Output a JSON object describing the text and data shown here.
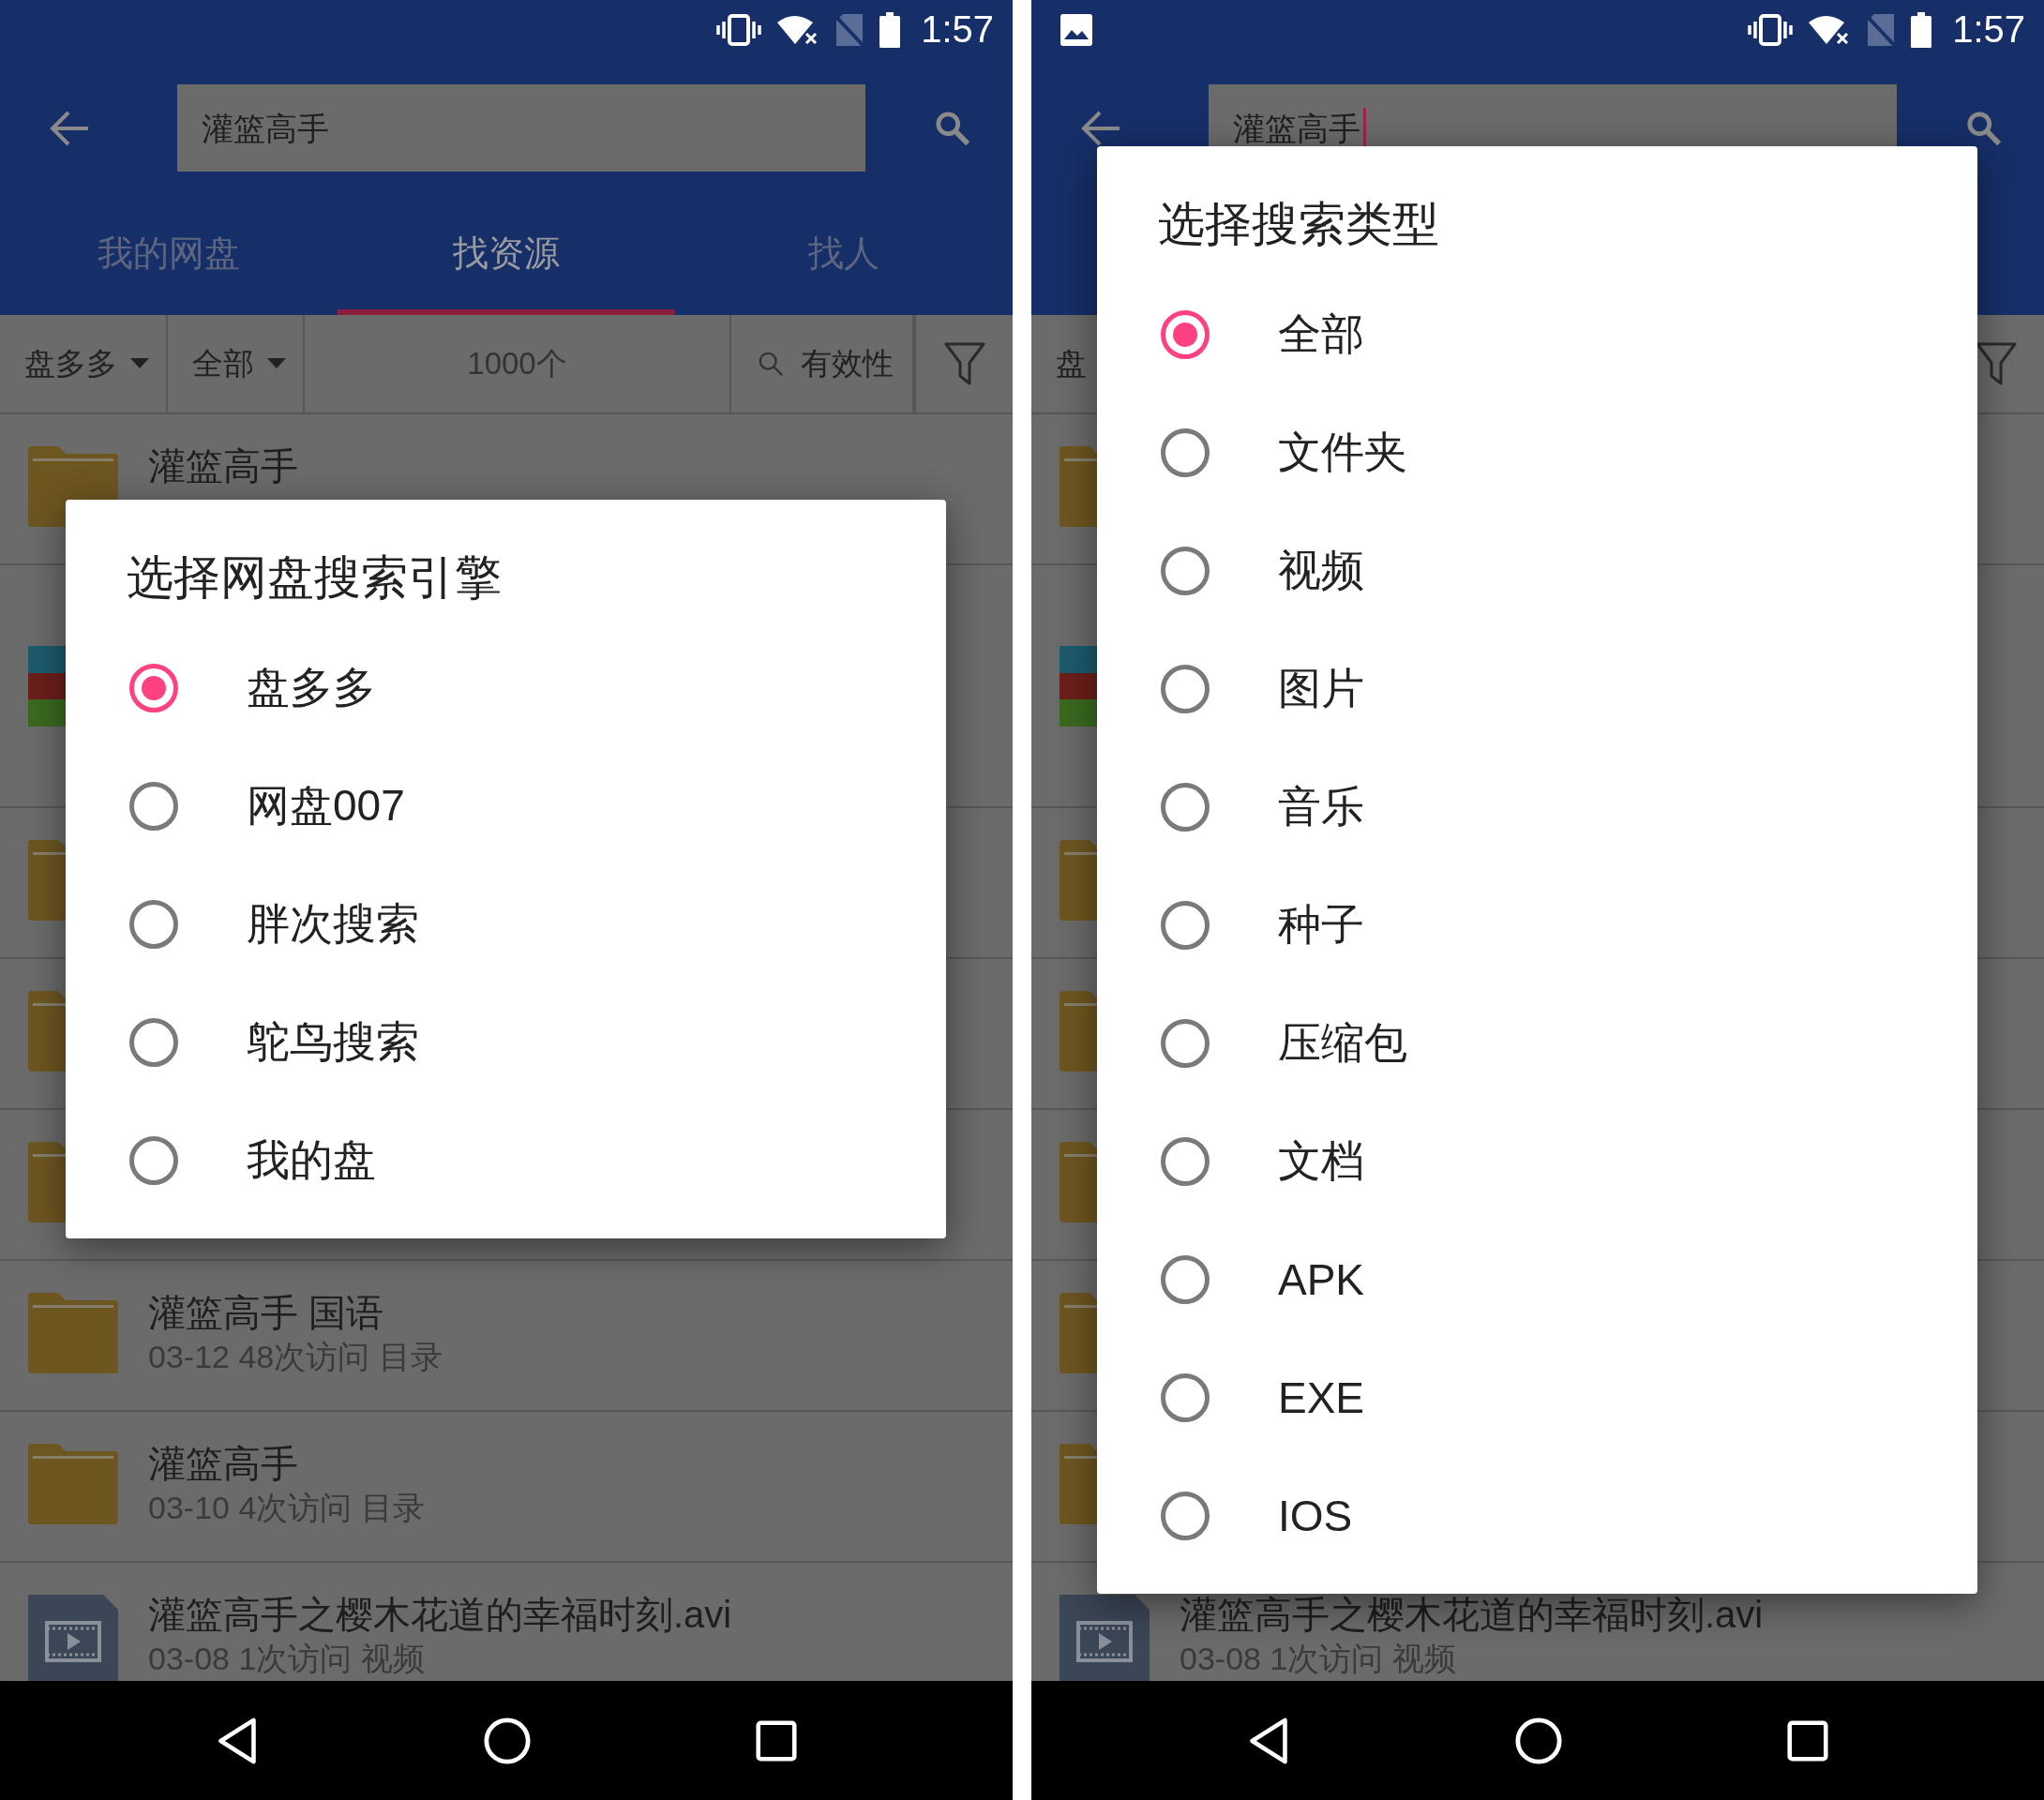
{
  "screens": [
    {
      "status_bar": {
        "time": "1:57"
      },
      "search": {
        "value": "灌篮高手",
        "cursor": false
      },
      "tabs": [
        {
          "label": "我的网盘",
          "selected": false
        },
        {
          "label": "找资源",
          "selected": true
        },
        {
          "label": "找人",
          "selected": false
        }
      ],
      "filters": [
        {
          "kind": "dropdown",
          "label": "盘多多"
        },
        {
          "kind": "dropdown",
          "label": "全部"
        },
        {
          "kind": "count",
          "label": "1000个"
        },
        {
          "kind": "search",
          "label": "有效性"
        },
        {
          "kind": "filter"
        }
      ],
      "rows": [
        {
          "kind": "folder",
          "title": "灌篮高手"
        },
        {
          "kind": "archive"
        },
        {
          "kind": "folder"
        },
        {
          "kind": "folder"
        },
        {
          "kind": "folder"
        },
        {
          "kind": "folder",
          "title": "灌篮高手 国语",
          "subtitle": "03-12 48次访问 目录"
        },
        {
          "kind": "folder",
          "title": "灌篮高手",
          "subtitle": "03-10 4次访问 目录"
        },
        {
          "kind": "video",
          "title": "灌篮高手之樱木花道的幸福时刻.avi",
          "subtitle": "03-08 1次访问 视频"
        }
      ],
      "dialog": {
        "title": "选择网盘搜索引擎",
        "options": [
          {
            "label": "盘多多",
            "selected": true
          },
          {
            "label": "网盘007",
            "selected": false
          },
          {
            "label": "胖次搜索",
            "selected": false
          },
          {
            "label": "鸵鸟搜索",
            "selected": false
          },
          {
            "label": "我的盘",
            "selected": false
          }
        ]
      }
    },
    {
      "status_bar": {
        "time": "1:57"
      },
      "notifications": [
        {
          "kind": "picture"
        }
      ],
      "search": {
        "value": "灌篮高手",
        "cursor": true
      },
      "filters": [
        {
          "kind": "text",
          "label": "盘"
        },
        {
          "kind": "filter"
        }
      ],
      "rows": [
        {
          "kind": "folder"
        },
        {
          "kind": "archive"
        },
        {
          "kind": "folder"
        },
        {
          "kind": "folder"
        },
        {
          "kind": "folder"
        },
        {
          "kind": "folder"
        },
        {
          "kind": "folder"
        },
        {
          "kind": "video",
          "title": "灌篮高手之樱木花道的幸福时刻.avi",
          "subtitle": "03-08 1次访问 视频"
        }
      ],
      "dialog": {
        "title": "选择搜索类型",
        "options": [
          {
            "label": "全部",
            "selected": true
          },
          {
            "label": "文件夹",
            "selected": false
          },
          {
            "label": "视频",
            "selected": false
          },
          {
            "label": "图片",
            "selected": false
          },
          {
            "label": "音乐",
            "selected": false
          },
          {
            "label": "种子",
            "selected": false
          },
          {
            "label": "压缩包",
            "selected": false
          },
          {
            "label": "文档",
            "selected": false
          },
          {
            "label": "APK",
            "selected": false
          },
          {
            "label": "EXE",
            "selected": false
          },
          {
            "label": "IOS",
            "selected": false
          }
        ]
      }
    }
  ]
}
